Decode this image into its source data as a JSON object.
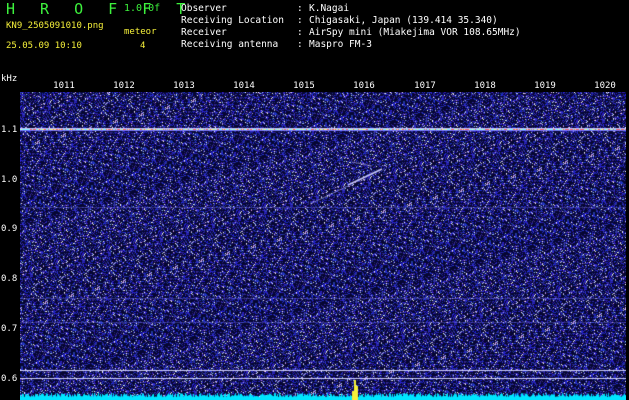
{
  "header": {
    "app_title": "H R O F F T",
    "version": "1.0.0f",
    "file_name": "KN9_2505091010.png",
    "mode_label": "meteor",
    "datetime": "25.05.09 10:10",
    "mode_value": "4"
  },
  "info": [
    {
      "label": "Observer",
      "value": "K.Nagai"
    },
    {
      "label": "Receiving Location",
      "value": "Chigasaki, Japan (139.414 35.340)"
    },
    {
      "label": "Receiver",
      "value": "AirSpy mini (Miakejima VOR 108.65MHz)"
    },
    {
      "label": "Receiving antenna",
      "value": "Maspro FM-3"
    }
  ],
  "axis": {
    "y_unit": "kHz",
    "y_ticks": [
      "1.1",
      "1.0",
      "0.9",
      "0.8",
      "0.7",
      "0.6"
    ],
    "x_ticks": [
      "1011",
      "1012",
      "1013",
      "1014",
      "1015",
      "1016",
      "1017",
      "1018",
      "1019",
      "1020"
    ]
  },
  "colors": {
    "title_green": "#3df23d",
    "accent_yellow": "#f5f03a",
    "background": "#000000",
    "noise_blue": "#1f1fb8",
    "spectrum_cyan": "#00e5ff"
  }
}
